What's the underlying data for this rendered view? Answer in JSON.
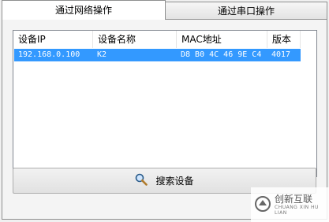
{
  "tabs": [
    {
      "label": "通过网络操作",
      "active": true
    },
    {
      "label": "通过串口操作",
      "active": false
    }
  ],
  "table": {
    "columns": [
      "设备IP",
      "设备名称",
      "MAC地址",
      "版本"
    ],
    "rows": [
      {
        "ip": "192.168.0.100",
        "name": "K2",
        "mac": "D8 B0 4C 46 9E C4",
        "version": "4017",
        "selected": true
      }
    ]
  },
  "search_button": {
    "label": "搜索设备",
    "icon": "search-icon"
  },
  "watermark": {
    "cn": "创新互联",
    "en": "CHUANG XIN HU LIAN"
  },
  "colors": {
    "selection": "#3399ff",
    "panel_bg": "#f4f4f4"
  }
}
